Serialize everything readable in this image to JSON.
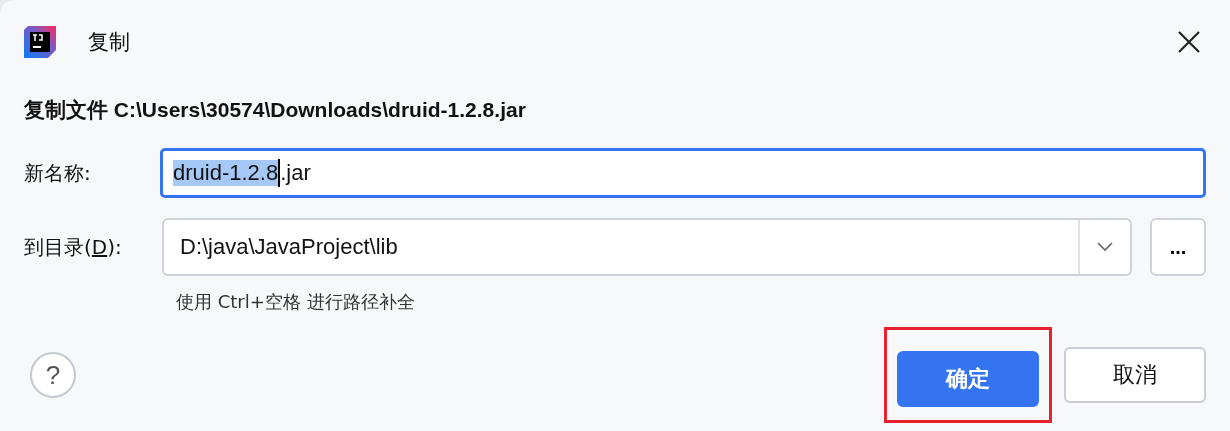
{
  "window": {
    "title": "复制"
  },
  "heading": "复制文件 C:\\Users\\30574\\Downloads\\druid-1.2.8.jar",
  "new_name": {
    "label": "新名称:",
    "focused": true,
    "parts": [
      {
        "text": "druid-1.2.8",
        "selected": true
      },
      {
        "text": ".jar",
        "selected": false
      }
    ]
  },
  "directory": {
    "label_before": "到目录(",
    "mnemonic": "D",
    "label_after": "):",
    "value": "D:\\java\\JavaProject\\lib",
    "browse": "...",
    "hint": "使用 Ctrl+空格 进行路径补全"
  },
  "help": "?",
  "buttons": [
    {
      "label": "确定",
      "kind": "primary",
      "highlighted": true
    },
    {
      "label": "取消",
      "kind": "secondary",
      "highlighted": false
    }
  ]
}
